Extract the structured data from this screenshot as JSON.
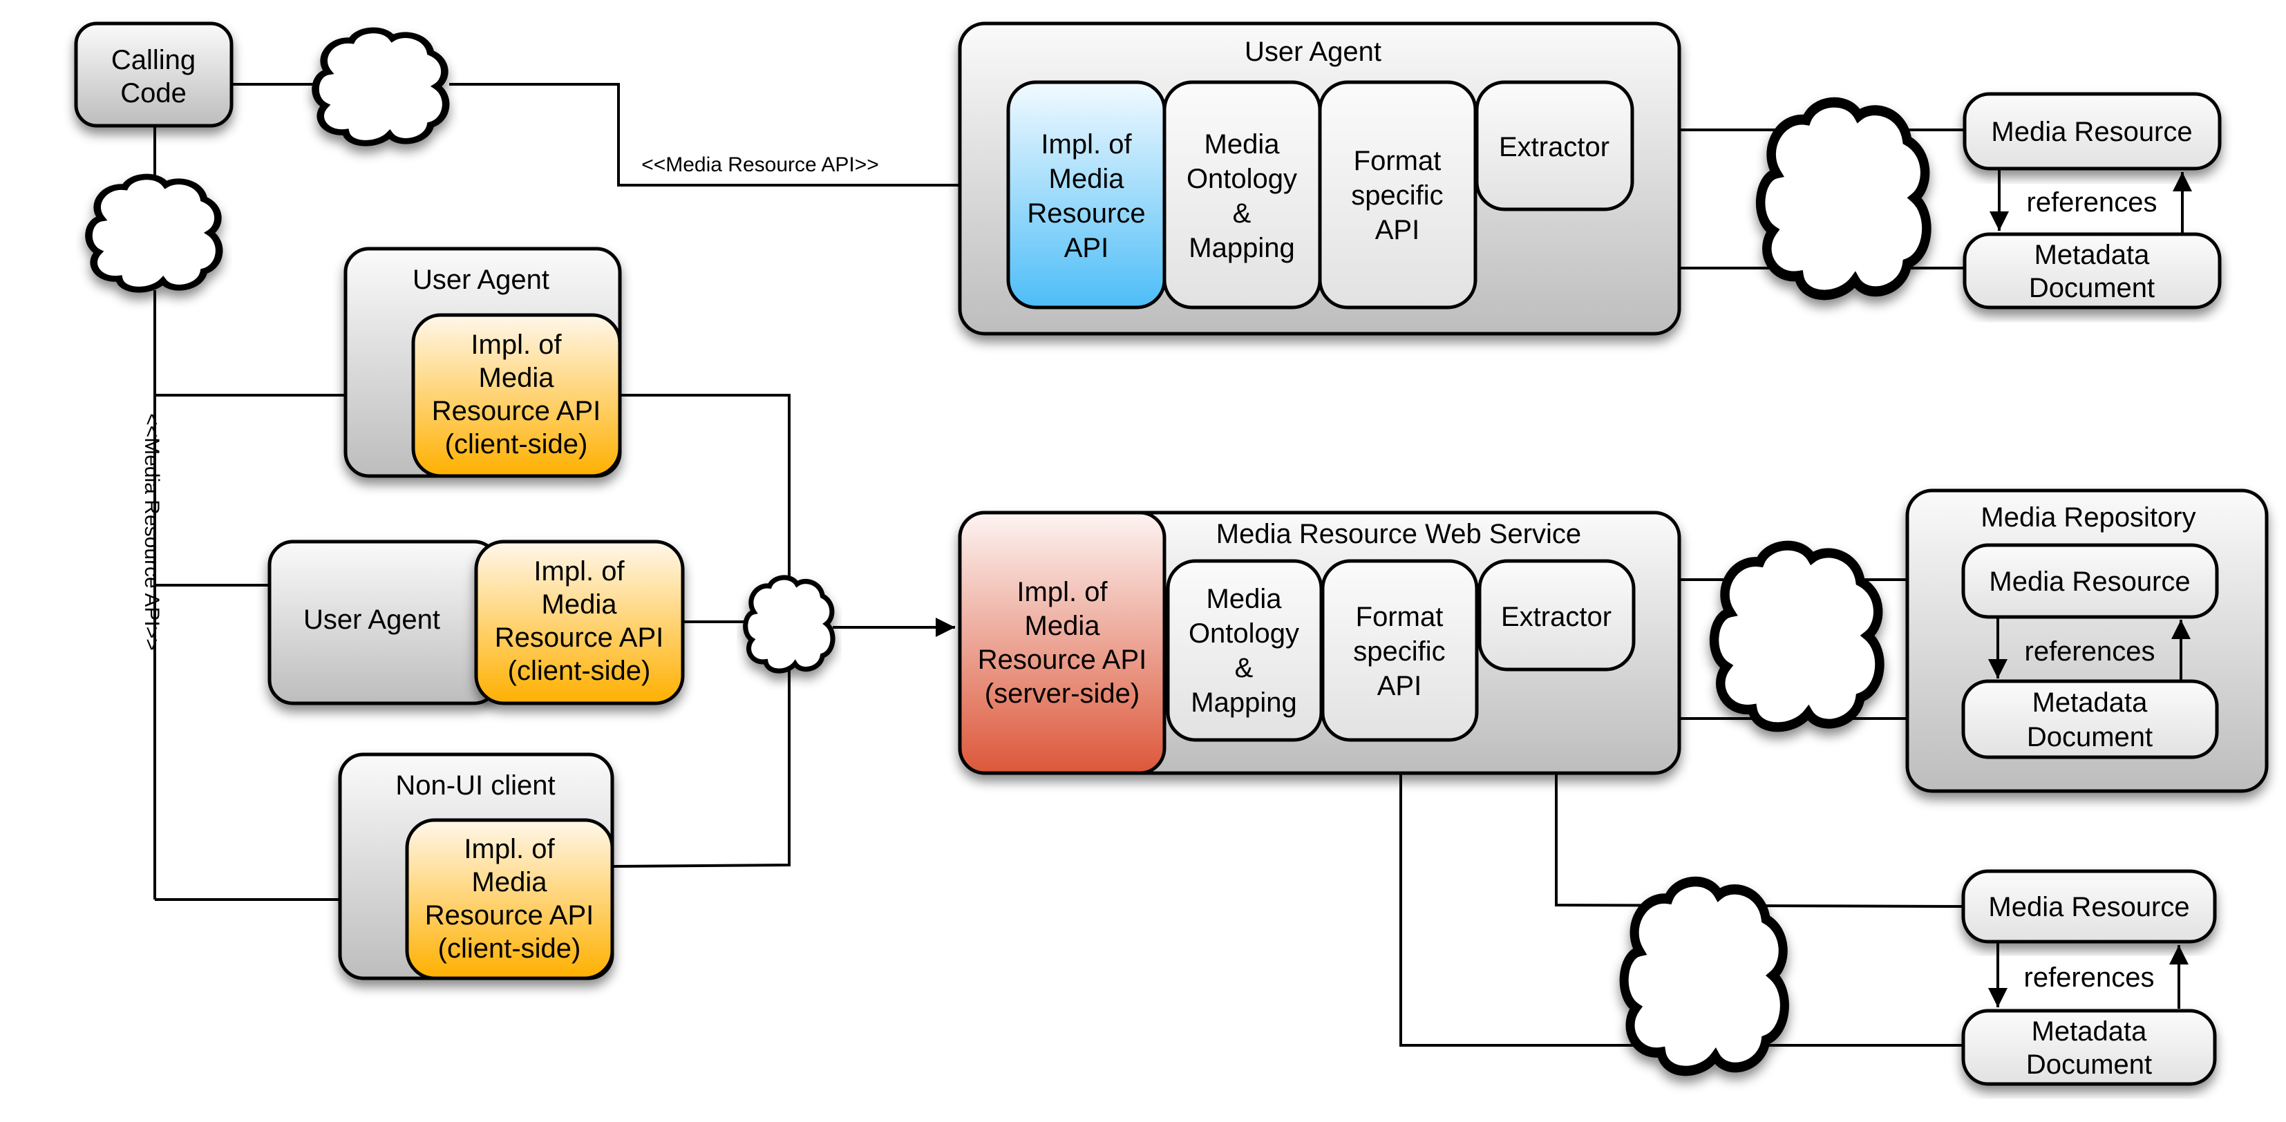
{
  "colors": {
    "blue_accent": "#4dbdf7",
    "orange_accent": "#ffb000",
    "red_accent": "#dc573a",
    "gray_fill": "#c4c4c4"
  },
  "calling_code": {
    "lines": [
      "Calling",
      "Code"
    ]
  },
  "connector_labels": {
    "top": "<<Media Resource API>>",
    "left_vertical": "<<Media Resource API>>"
  },
  "top_user_agent": {
    "title": "User Agent",
    "impl": [
      "Impl. of",
      "Media",
      "Resource",
      "API"
    ],
    "ontology": [
      "Media",
      "Ontology",
      "&",
      "Mapping"
    ],
    "format": [
      "Format",
      "specific",
      "API"
    ],
    "extractor": "Extractor"
  },
  "top_right_resources": {
    "media_resource": "Media Resource",
    "references": "references",
    "metadata": [
      "Metadata",
      "Document"
    ]
  },
  "client_user_agent_1": {
    "title": "User Agent",
    "impl": [
      "Impl. of",
      "Media",
      "Resource API",
      "(client-side)"
    ]
  },
  "client_user_agent_2": {
    "title": "User Agent",
    "impl": [
      "Impl. of",
      "Media",
      "Resource API",
      "(client-side)"
    ]
  },
  "non_ui_client": {
    "title": "Non-UI client",
    "impl": [
      "Impl. of",
      "Media",
      "Resource API",
      "(client-side)"
    ]
  },
  "web_service": {
    "title": "Media Resource Web Service",
    "impl": [
      "Impl. of",
      "Media",
      "Resource API",
      "(server-side)"
    ],
    "ontology": [
      "Media",
      "Ontology",
      "&",
      "Mapping"
    ],
    "format": [
      "Format",
      "specific",
      "API"
    ],
    "extractor": "Extractor"
  },
  "media_repository": {
    "title": "Media Repository",
    "media_resource": "Media Resource",
    "references": "references",
    "metadata": [
      "Metadata",
      "Document"
    ]
  },
  "bottom_resources": {
    "media_resource": "Media Resource",
    "references": "references",
    "metadata": [
      "Metadata",
      "Document"
    ]
  }
}
